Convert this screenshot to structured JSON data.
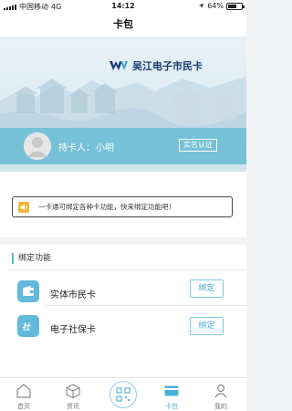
{
  "status_bar": {
    "carrier": "中国移动",
    "network": "4G",
    "time": "14:12",
    "battery": "64%",
    "battery_level": 0.64
  },
  "nav": {
    "title": "卡包"
  },
  "card": {
    "brand": "吴江电子市民卡",
    "holder_label": "持卡人：",
    "holder_name": "小明",
    "verify_label": "实名认证"
  },
  "notice": {
    "text": "一卡通可绑定各种卡功能，快来绑定功能吧！"
  },
  "bind_section": {
    "title": "绑定功能",
    "items": [
      {
        "label": "实体市民卡",
        "button": "绑定",
        "icon": "wallet-icon"
      },
      {
        "label": "电子社保卡",
        "button": "绑定",
        "icon": "social-security-icon"
      }
    ]
  },
  "tabs": [
    {
      "label": "首页",
      "icon": "home-icon"
    },
    {
      "label": "资讯",
      "icon": "cube-icon"
    },
    {
      "label": "",
      "icon": "qr-scan-icon"
    },
    {
      "label": "卡包",
      "icon": "card-icon"
    },
    {
      "label": "我的",
      "icon": "user-icon"
    }
  ],
  "colors": {
    "accent": "#5ab6d8",
    "band": "#6ebed6",
    "brand_text": "#1a3c73"
  }
}
